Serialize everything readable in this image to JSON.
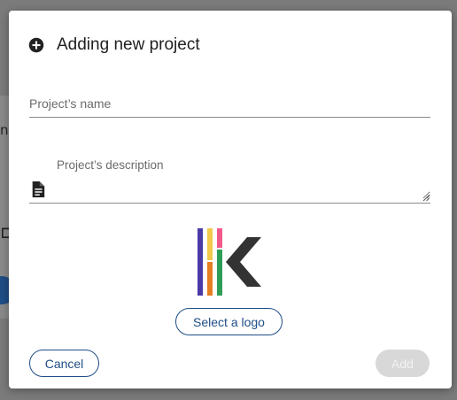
{
  "background": {
    "fragment_text": "no",
    "fragment_glyph": "⊏"
  },
  "dialog": {
    "title": "Adding new project",
    "title_icon": "add-circle-icon",
    "name_field": {
      "placeholder": "Project’s name",
      "value": ""
    },
    "description_field": {
      "label": "Project’s description",
      "value": "",
      "icon": "document-icon"
    },
    "logo": {
      "icon": "kanban-k-logo"
    },
    "select_logo_label": "Select a logo",
    "cancel_label": "Cancel",
    "add_label": "Add",
    "add_disabled": true
  },
  "colors": {
    "primary": "#1f4d86",
    "disabled_bg": "#d8d8d8",
    "logo_bars": [
      "#4a3aa6",
      "#f2c94c",
      "#ef5a8a",
      "#2e9e57",
      "#e67e22",
      "#e84a3a"
    ],
    "logo_chevron": "#333333"
  }
}
